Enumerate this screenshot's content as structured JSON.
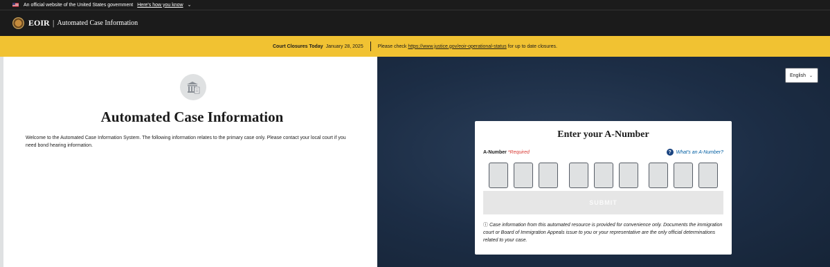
{
  "gov_banner": {
    "text": "An official website of the United States government",
    "link": "Here's how you know",
    "chevron": "⌄"
  },
  "header": {
    "acronym": "EOIR",
    "separator": "|",
    "title": "Automated Case Information"
  },
  "alert": {
    "label": "Court Closures Today",
    "date": "January 28, 2025",
    "text_before": "Please check",
    "link": "https://www.justice.gov/eoir-operational-status",
    "text_after": "for up to date closures."
  },
  "left": {
    "icon": "courthouse-document-icon",
    "title": "Automated Case Information",
    "description": "Welcome to the Automated Case Information System. The following information relates to the primary case only. Please contact your local court if you need bond hearing information."
  },
  "right": {
    "language": "English",
    "language_chevron": "⌄",
    "card": {
      "title": "Enter your A-Number",
      "label": "A-Number",
      "required": "*Required",
      "help_icon": "?",
      "help_link": "What's an A-Number?",
      "submit": "SUBMIT",
      "info_icon": "ⓘ",
      "disclaimer": "Case information from this automated resource is provided for convenience only. Documents the immigration court or Board of Immigration Appeals issue to you or your representative are the only official determinations related to your case."
    }
  },
  "colors": {
    "header_bg": "#1b1b1b",
    "alert_bg": "#f1c232",
    "right_bg": "#1c2d45",
    "link": "#005ea2",
    "required": "#d83933"
  }
}
